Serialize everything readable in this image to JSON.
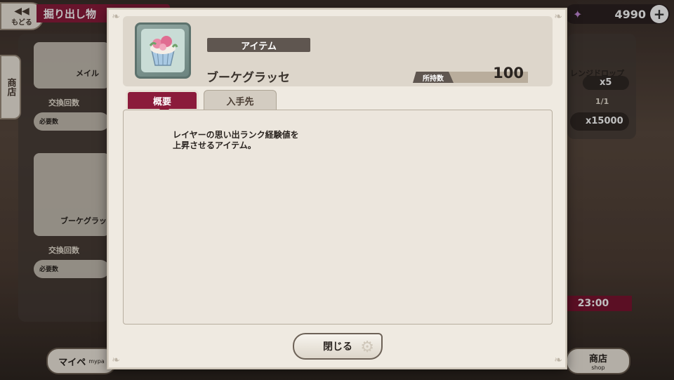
{
  "background": {
    "back_button_label": "もどる",
    "title": "掘り出し物",
    "currency_value": "4990",
    "side_tab_label": "商店",
    "cards": [
      {
        "name": "メイル",
        "exchange_label": "交換回数",
        "cost_label": "必要数"
      },
      {
        "name": "ブーケグラッセ",
        "exchange_label": "交換回数",
        "cost_label": "必要数"
      }
    ],
    "right_card": {
      "name": "レンジドロップ",
      "count": "x5",
      "exchange": "1/1",
      "price": "x15000"
    },
    "timer": "23:00",
    "bottom_left_label": "マイペ",
    "bottom_left_sub": "mypa",
    "bottom_right_label": "商店",
    "bottom_right_sub": "shop"
  },
  "modal": {
    "category": "アイテム",
    "item_name": "ブーケグラッセ",
    "owned_label": "所持数",
    "owned_count": "100",
    "tabs": [
      {
        "label": "概要",
        "active": true
      },
      {
        "label": "入手先",
        "active": false
      }
    ],
    "description": "レイヤーの思い出ランク経験値を\n上昇させるアイテム。",
    "close_label": "閉じる"
  },
  "colors": {
    "accent": "#8b1b3b",
    "panel": "#efeae1",
    "label_dark": "#5f5650"
  },
  "icons": [
    "back-arrow-icon",
    "plus-icon",
    "coin-icon",
    "cupcake-icon",
    "gear-icon"
  ]
}
